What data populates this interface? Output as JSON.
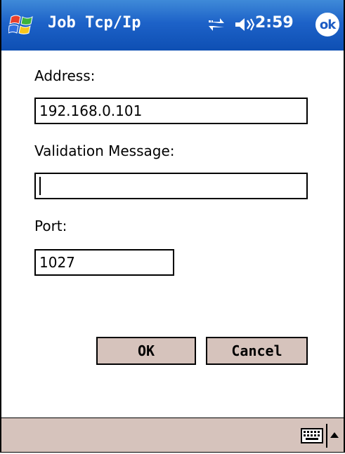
{
  "titlebar": {
    "title": "Job Tcp/Ip",
    "time": "2:59",
    "ok_label": "ok",
    "icons": [
      "windows-start-icon",
      "connectivity-icon",
      "speaker-icon"
    ]
  },
  "form": {
    "address_label": "Address:",
    "address_value": "192.168.0.101",
    "validation_label": "Validation Message:",
    "validation_value": "",
    "port_label": "Port:",
    "port_value": "1027"
  },
  "buttons": {
    "ok_label": "OK",
    "cancel_label": "Cancel"
  },
  "menubar": {
    "icons": [
      "keyboard-icon",
      "sip-arrow-up-icon"
    ]
  },
  "colors": {
    "titlebar": "#1d62c8",
    "button_face": "#d6c3bc",
    "menubar": "#d6c3bc"
  }
}
